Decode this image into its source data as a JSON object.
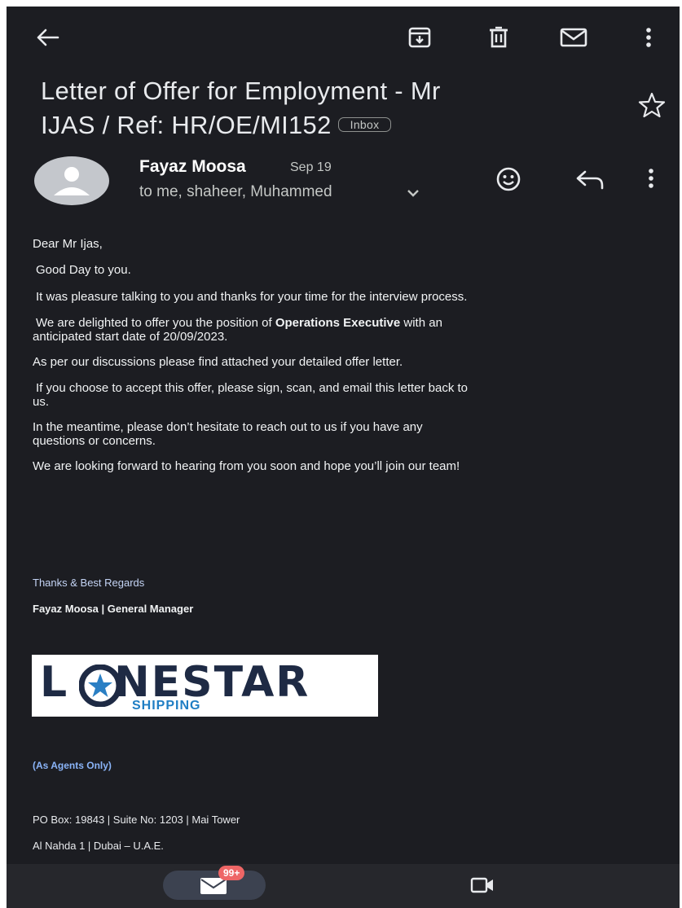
{
  "toolbar": {
    "back_icon": "arrow-left-icon",
    "archive_icon": "archive-icon",
    "delete_icon": "trash-icon",
    "mark_unread_icon": "mail-icon",
    "more_icon": "more-vert-icon"
  },
  "email": {
    "subject_line1": "Letter of Offer for Employment - Mr",
    "subject_line2": "IJAS / Ref: HR/OE/MI152",
    "label": "Inbox",
    "starred": false
  },
  "sender": {
    "name": "Fayaz Moosa",
    "date": "Sep 19",
    "recipients": "to me, shaheer, Muhammed"
  },
  "body": {
    "greeting": "Dear Mr Ijas,",
    "line1": "Good Day to you.",
    "line2": "It was pleasure talking to you and thanks for your time for the interview process.",
    "line3_part1": "We are delighted to offer you the position of ",
    "line3_bold": "Operations Executive",
    "line3_part2": " with an",
    "line3_cont": "anticipated start date of 20/09/2023.",
    "line4": "As per our discussions please find attached your detailed offer letter.",
    "line5a": "If you choose to accept this offer, please sign, scan, and email this letter back to",
    "line5b": "us.",
    "line6a": "In the meantime, please don’t hesitate to reach out to us if you have any",
    "line6b": "questions or concerns.",
    "line7": "We are looking forward to hearing from you soon and hope you’ll join our team!"
  },
  "signature": {
    "thanks": "Thanks & Best Regards",
    "name_title": "Fayaz Moosa | General Manager",
    "logo_text_1": "L",
    "logo_text_2": "NESTAR",
    "logo_sub": "SHIPPING",
    "agents": "(As Agents Only)",
    "address1": "PO Box: 19843 | Suite No: 1203 | Mai Tower",
    "address2": "Al Nahda 1 | Dubai – U.A.E."
  },
  "bottom_nav": {
    "mail_badge": "99+",
    "mail_icon": "mail-icon",
    "meet_icon": "video-icon"
  },
  "colors": {
    "background": "#1c1d22",
    "text": "#e8eaed",
    "link": "#8ab4f8",
    "badge": "#ee6666"
  }
}
